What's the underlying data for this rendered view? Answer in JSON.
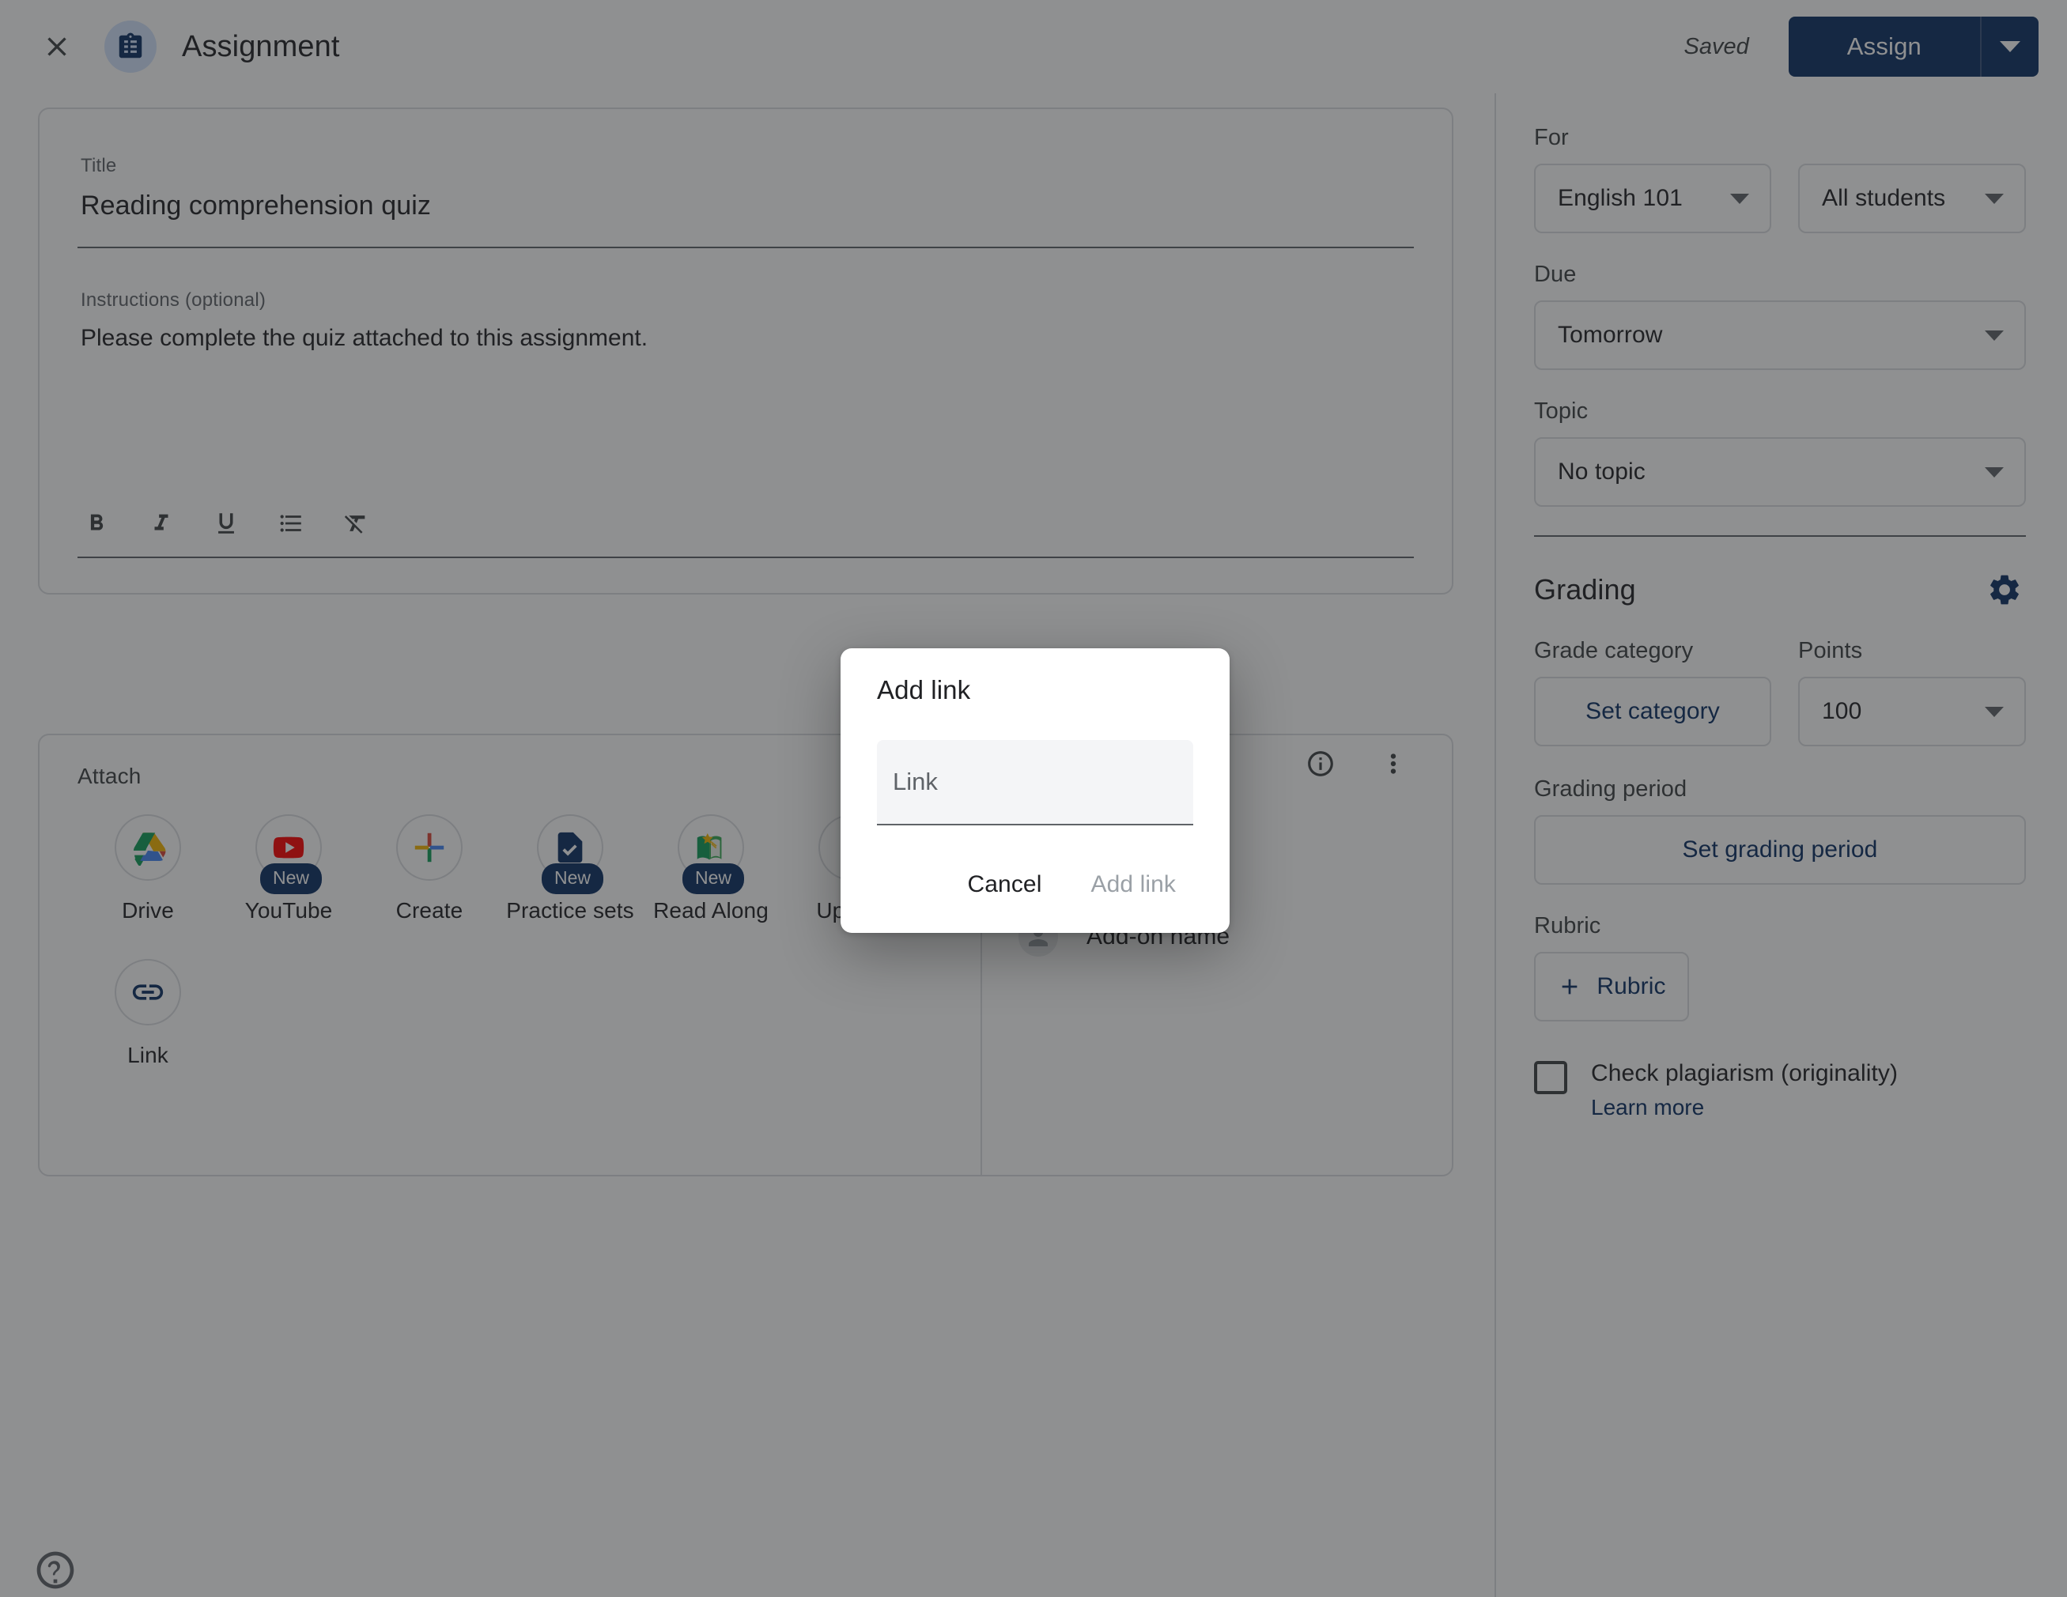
{
  "header": {
    "close_icon": "close-icon",
    "assignment_icon": "assignment-clipboard-icon",
    "title": "Assignment",
    "saved_status": "Saved",
    "assign_label": "Assign",
    "assign_caret_icon": "chevron-down-icon"
  },
  "detail": {
    "title_label": "Title",
    "title_value": "Reading comprehension quiz",
    "instructions_label": "Instructions (optional)",
    "instructions_value": "Please complete the quiz attached to this assignment.",
    "format_tools": [
      {
        "name": "bold-icon",
        "label": "B"
      },
      {
        "name": "italic-icon",
        "label": "I"
      },
      {
        "name": "underline-icon",
        "label": "U"
      },
      {
        "name": "bulleted-list-icon",
        "label": "List"
      },
      {
        "name": "clear-formatting-icon",
        "label": "Clear formatting"
      }
    ]
  },
  "attach": {
    "heading": "Attach",
    "items": [
      {
        "label": "Drive",
        "icon": "google-drive-icon",
        "badge": null
      },
      {
        "label": "YouTube",
        "icon": "youtube-icon",
        "badge": "New"
      },
      {
        "label": "Create",
        "icon": "create-plus-icon",
        "badge": null
      },
      {
        "label": "Practice sets",
        "icon": "practice-sets-icon",
        "badge": "New"
      },
      {
        "label": "Read Along",
        "icon": "read-along-icon",
        "badge": "New"
      },
      {
        "label": "Upload",
        "icon": "upload-icon",
        "badge": null
      },
      {
        "label": "Link",
        "icon": "link-icon",
        "badge": null
      }
    ],
    "addons": {
      "info_icon": "info-circle-icon",
      "more_icon": "more-vertical-icon",
      "items": [
        {
          "label": "Add-on name",
          "icon": "person-avatar-icon"
        },
        {
          "label": "Add-on name",
          "icon": "person-avatar-icon"
        }
      ]
    }
  },
  "help": {
    "icon": "help-circle-icon"
  },
  "sidebar": {
    "for_label": "For",
    "course_value": "English 101",
    "students_value": "All students",
    "due_label": "Due",
    "due_value": "Tomorrow",
    "topic_label": "Topic",
    "topic_value": "No topic",
    "grading_title": "Grading",
    "grading_settings_icon": "gear-icon",
    "grade_category_label": "Grade category",
    "grade_category_button": "Set category",
    "points_label": "Points",
    "points_value": "100",
    "grading_period_label": "Grading period",
    "grading_period_button": "Set grading period",
    "rubric_label": "Rubric",
    "rubric_button": "Rubric",
    "rubric_icon": "plus-icon",
    "plagiarism_label": "Check plagiarism (originality)",
    "plagiarism_learn_more": "Learn more"
  },
  "modal": {
    "title": "Add link",
    "input_placeholder": "Link",
    "input_value": "",
    "cancel_label": "Cancel",
    "confirm_label": "Add link"
  },
  "colors": {
    "brand_blue": "#0b2e63",
    "scrim": "rgba(32,33,36,0.50)",
    "border": "#dadce0",
    "text_primary": "#202124",
    "text_secondary": "#5f6368"
  }
}
